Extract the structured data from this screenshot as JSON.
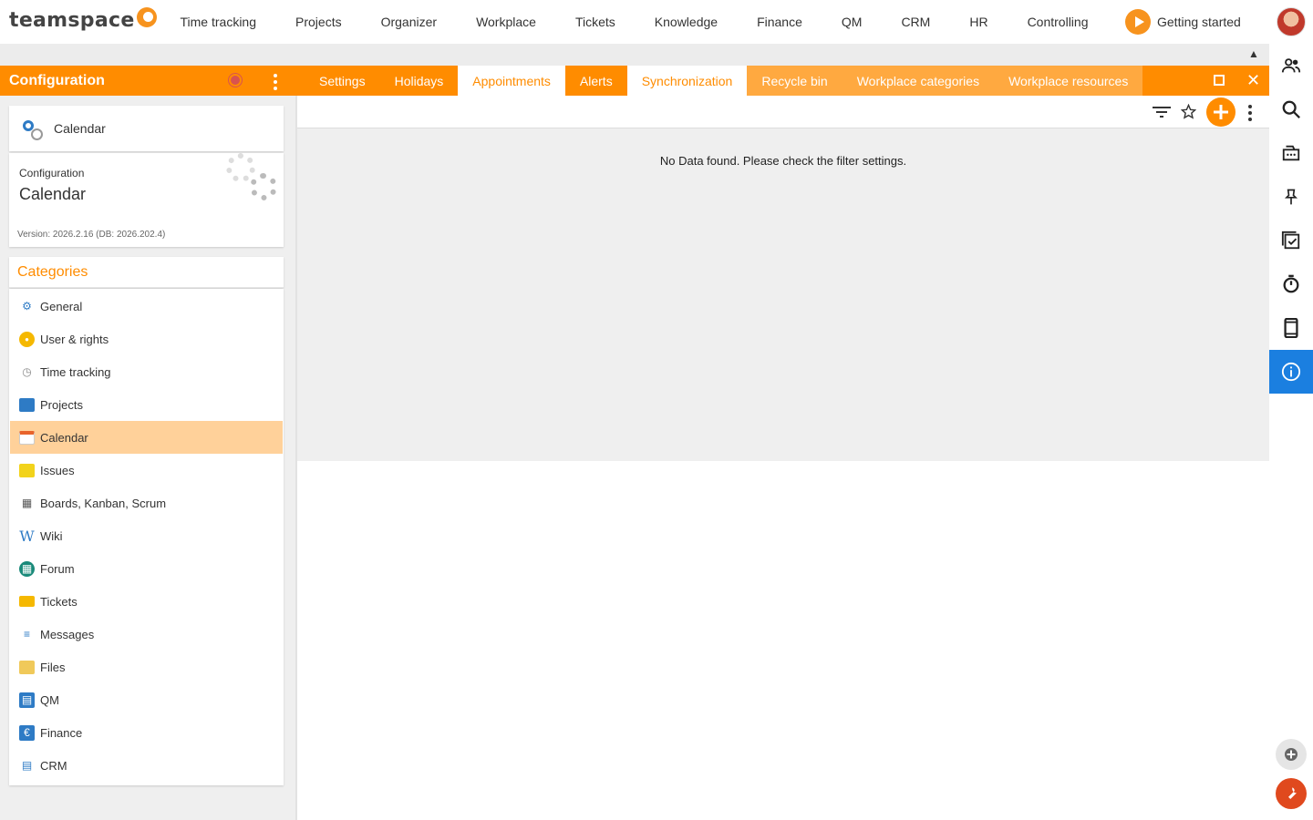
{
  "app": {
    "logo_text": "teamspace"
  },
  "mainnav": [
    "Time tracking",
    "Projects",
    "Organizer",
    "Workplace",
    "Tickets",
    "Knowledge",
    "Finance",
    "QM",
    "CRM",
    "HR",
    "Controlling"
  ],
  "getting_started": "Getting started",
  "config_panel": {
    "title": "Configuration",
    "selected_module": "Calendar",
    "info_label": "Configuration",
    "info_title": "Calendar",
    "version": "Version: 2026.2.16 (DB: 2026.202.4)"
  },
  "categories": {
    "title": "Categories",
    "items": [
      {
        "label": "General",
        "icon": "gears-icon",
        "color": "#2e7bc5"
      },
      {
        "label": "User & rights",
        "icon": "users-icon",
        "color": "#f5b800"
      },
      {
        "label": "Time tracking",
        "icon": "stopwatch-icon",
        "color": "#888888"
      },
      {
        "label": "Projects",
        "icon": "folder-icon",
        "color": "#2e7bc5"
      },
      {
        "label": "Calendar",
        "icon": "calendar-icon",
        "color": "#e8632b",
        "active": true
      },
      {
        "label": "Issues",
        "icon": "sticky-note-icon",
        "color": "#f2d31b"
      },
      {
        "label": "Boards, Kanban, Scrum",
        "icon": "board-icon",
        "color": "#555555"
      },
      {
        "label": "Wiki",
        "icon": "wiki-icon",
        "color": "#2e7bc5"
      },
      {
        "label": "Forum",
        "icon": "forum-icon",
        "color": "#1a8a7a"
      },
      {
        "label": "Tickets",
        "icon": "ticket-icon",
        "color": "#f5b800"
      },
      {
        "label": "Messages",
        "icon": "messages-icon",
        "color": "#2e7bc5"
      },
      {
        "label": "Files",
        "icon": "files-icon",
        "color": "#f0c95a"
      },
      {
        "label": "QM",
        "icon": "qm-icon",
        "color": "#2e7bc5"
      },
      {
        "label": "Finance",
        "icon": "finance-icon",
        "color": "#2e7bc5"
      },
      {
        "label": "CRM",
        "icon": "crm-icon",
        "color": "#2e7bc5"
      }
    ]
  },
  "tabs": [
    {
      "label": "Settings",
      "style": "orange"
    },
    {
      "label": "Holidays",
      "style": "orange"
    },
    {
      "label": "Appointments",
      "style": "white"
    },
    {
      "label": "Alerts",
      "style": "orange"
    },
    {
      "label": "Synchronization",
      "style": "white"
    },
    {
      "label": "Recycle bin",
      "style": "light"
    },
    {
      "label": "Workplace categories",
      "style": "light"
    },
    {
      "label": "Workplace resources",
      "style": "light"
    }
  ],
  "empty_message": "No Data found. Please check the filter settings.",
  "right_rail": [
    "contacts-icon",
    "search-icon",
    "inbox-icon",
    "pin-icon",
    "tasks-icon",
    "timer-icon",
    "mobile-icon",
    "info-icon"
  ],
  "colors": {
    "accent": "#ff8c00",
    "active_item": "#ffd19a",
    "rail_active": "#1b7fe0"
  }
}
